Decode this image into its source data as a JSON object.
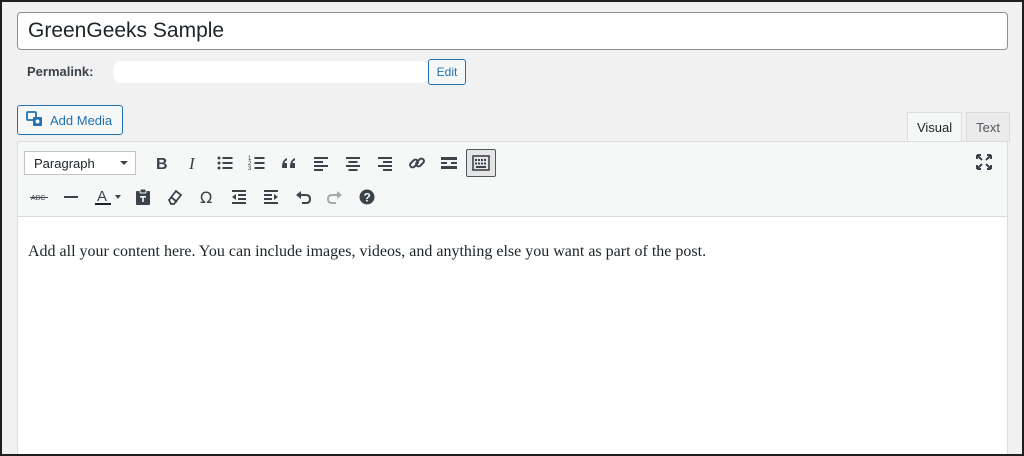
{
  "post": {
    "title": "GreenGeeks Sample",
    "permalink_label": "Permalink:",
    "edit_label": "Edit",
    "add_media_label": "Add Media"
  },
  "tabs": [
    {
      "label": "Visual",
      "active": true
    },
    {
      "label": "Text",
      "active": false
    }
  ],
  "toolbar": {
    "format_value": "Paragraph",
    "row1_icons": [
      "bold-icon",
      "italic-icon",
      "bulleted-list-icon",
      "numbered-list-icon",
      "blockquote-icon",
      "align-left-icon",
      "align-center-icon",
      "align-right-icon",
      "link-icon",
      "read-more-icon",
      "toolbar-toggle-icon"
    ],
    "row2_icons": [
      "strikethrough-icon",
      "horizontal-line-icon",
      "text-color-icon",
      "paste-text-icon",
      "clear-formatting-icon",
      "special-character-icon",
      "outdent-icon",
      "indent-icon",
      "undo-icon",
      "redo-icon",
      "help-icon"
    ],
    "strike_label": "ABC",
    "textcolor_label": "A",
    "omega": "Ω",
    "help": "?"
  },
  "content": {
    "body": "Add all your content here. You can include images, videos, and anything else you want as part of the post."
  },
  "colors": {
    "accent": "#2271b1",
    "toolbar_bg": "#f6f7f7",
    "page_bg": "#f1f1f1"
  }
}
